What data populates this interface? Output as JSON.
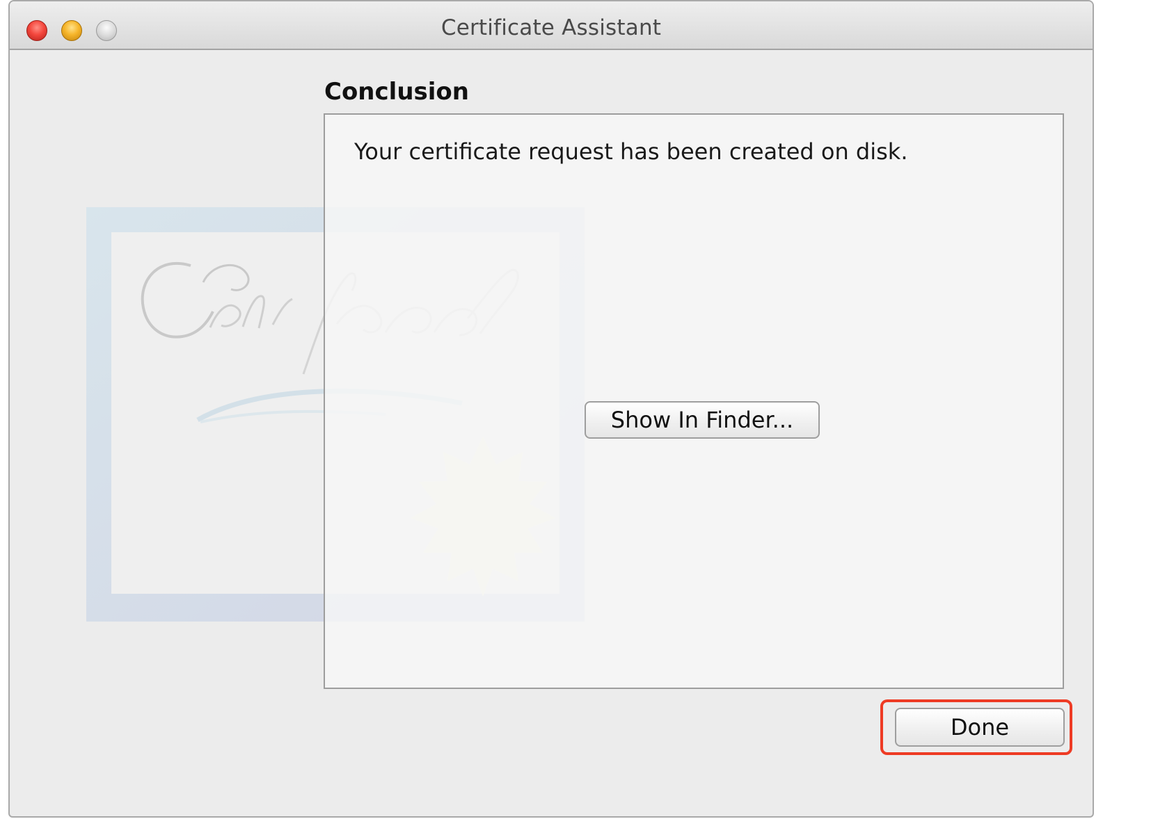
{
  "window": {
    "title": "Certificate Assistant"
  },
  "content": {
    "section_title": "Conclusion",
    "message": "Your certificate request has been created on disk."
  },
  "buttons": {
    "show_in_finder": "Show In Finder...",
    "done": "Done"
  },
  "colors": {
    "window_background": "#ececec",
    "highlight": "#ee3b24",
    "close": "#f4473d",
    "minimize": "#f6b52a"
  }
}
